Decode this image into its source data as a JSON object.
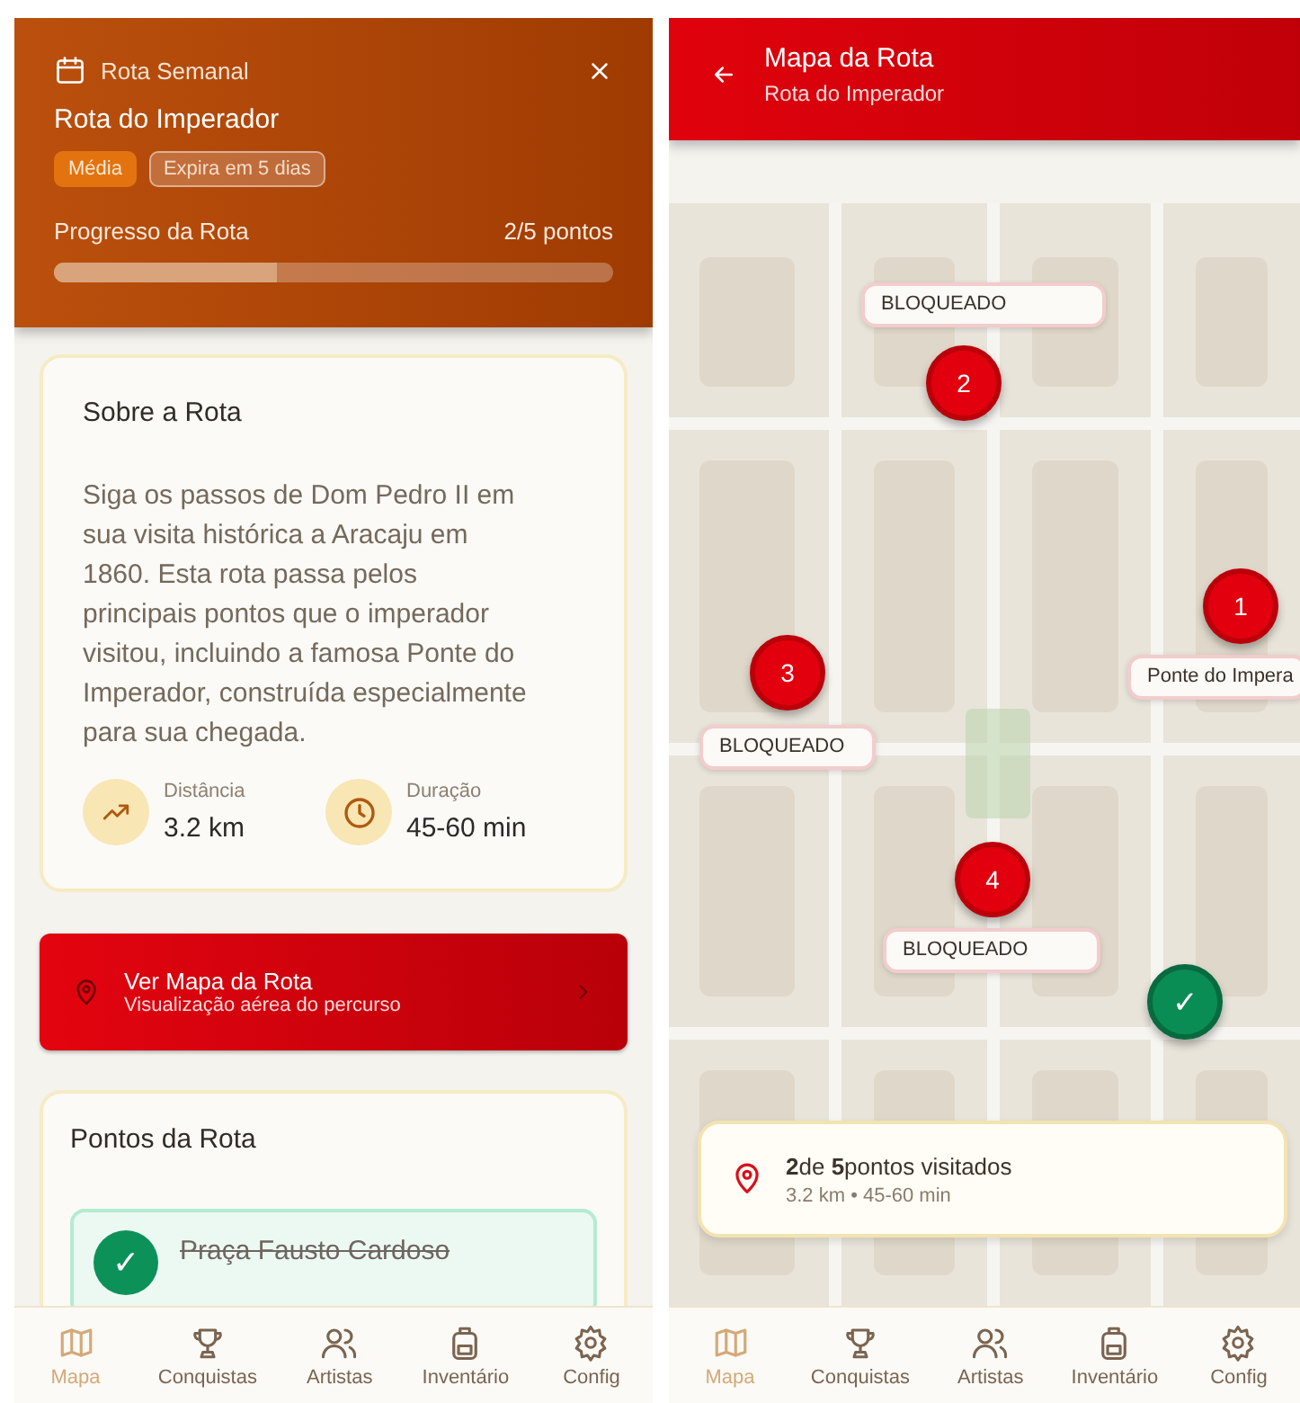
{
  "route_screen": {
    "header": {
      "eyebrow": "Rota Semanal",
      "title": "Rota do Imperador",
      "badges": [
        {
          "label": "Média",
          "kind": "difficulty"
        },
        {
          "label": "Expira em 5 dias",
          "kind": "expiry"
        }
      ],
      "progress_label": "Progresso da Rota",
      "progress_count": "2/5 pontos",
      "level": 0.4
    },
    "about": {
      "title": "Sobre a Rota",
      "description": "Siga os passos de Dom Pedro II em sua visita histórica a Aracaju em 1860. Esta rota passa pelos principais pontos que o imperador visitou, incluindo a famosa Ponte do Imperador, construída especialmente para sua chegada.",
      "stats": [
        {
          "kind": "distance",
          "label": "Distância",
          "value": "3.2 km"
        },
        {
          "kind": "duration",
          "label": "Duração",
          "value": "45-60 min"
        }
      ]
    },
    "map_button": {
      "title": "Ver Mapa da Rota",
      "subtitle": "Visualização aérea do percurso"
    },
    "points": {
      "title": "Pontos da Rota",
      "items": [
        {
          "name": "Praça Fausto Cardoso",
          "visited": true,
          "mark": "✓"
        }
      ]
    },
    "nav": [
      {
        "label": "Mapa",
        "selected": true
      },
      {
        "label": "Conquistas",
        "selected": false
      },
      {
        "label": "Artistas",
        "selected": false
      },
      {
        "label": "Inventário",
        "selected": false
      },
      {
        "label": "Config",
        "selected": false
      }
    ]
  },
  "map_screen": {
    "header": {
      "title": "Mapa da Rota",
      "subtitle": "Rota do Imperador"
    },
    "pins": [
      {
        "label": "2",
        "kind": "pending",
        "caption": "BLOQUEADO"
      },
      {
        "label": "1",
        "kind": "pending",
        "caption": "Ponte do Impera"
      },
      {
        "label": "3",
        "kind": "pending",
        "caption": "BLOQUEADO"
      },
      {
        "label": "4",
        "kind": "pending",
        "caption": "BLOQUEADO"
      },
      {
        "label": "✓",
        "kind": "visited"
      }
    ],
    "summary": {
      "text": "**2**de **5**pontos visitados",
      "details": "3.2 km • 45-60 min"
    },
    "nav": [
      {
        "label": "Mapa",
        "selected": true
      },
      {
        "label": "Conquistas",
        "selected": false
      },
      {
        "label": "Artistas",
        "selected": false
      },
      {
        "label": "Inventário",
        "selected": false
      },
      {
        "label": "Config",
        "selected": false
      }
    ]
  }
}
